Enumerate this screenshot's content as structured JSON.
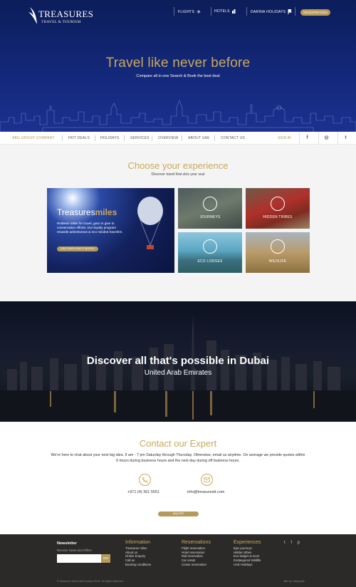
{
  "header": {
    "brand": "TREASURES",
    "brand_sub": "TRAVEL & TOURISM",
    "nav": [
      {
        "label": "FLIGHTS",
        "icon": "plane-icon"
      },
      {
        "label": "HOTELS",
        "icon": "building-icon"
      },
      {
        "label": "DARINA HOLIDAYS",
        "icon": "flag-icon"
      }
    ],
    "register_label": "REGISTRATION"
  },
  "hero": {
    "title": "Travel like never before",
    "subtitle": "Compare all in one Search & Book the best deal"
  },
  "main_nav": {
    "group": "ABG GROUP COMPANY",
    "items": [
      "HOT DEALS",
      "HOLIDAYS",
      "SERVICES",
      "OVERVIEW",
      "ABOUT UAE",
      "CONTACT US"
    ],
    "signin": "SIGN IN",
    "social": [
      "f",
      "◎",
      "t"
    ]
  },
  "experience": {
    "title": "Choose your experience",
    "subtitle": "Discover travel that stirs your soul",
    "miles": {
      "title_a": "Treasures",
      "title_b": "miles",
      "desc": "Redeem miles for travel, gear or give to conservation efforts. Our loyalty program rewards adventurous & eco minded travelers.",
      "button": "DISCOVER HOW IT WORKS"
    },
    "tiles": [
      "JOURNEYS",
      "HIDDEN TRIBES",
      "ECO LODGES",
      "WILDLIFE"
    ]
  },
  "dubai": {
    "title": "Discover all that's possible in Dubai",
    "subtitle": "United Arab Emirates"
  },
  "contact": {
    "title": "Contact our Expert",
    "desc": "We're here to chat about your next big idea. 9 am - 7 pm Saturday through Thursday. Otherwise, email us anytime. On average we provide quotes within 6 hours during business hours and the next day during off business hours.",
    "phone": "+971 (4) 361 5551",
    "email": "info@treasurestt.com",
    "button": "INQUIRE"
  },
  "footer": {
    "newsletter_title": "Newsletter",
    "newsletter_sub": "Receive News and Offers",
    "go": "GO",
    "columns": [
      {
        "heading": "Information",
        "items": [
          "Treasures miles",
          "About us",
          "Online Enquiry",
          "Call us",
          "Booking conditions"
        ]
      },
      {
        "heading": "Reservations",
        "items": [
          "Flight reservation",
          "Hotel reservation",
          "Rail reservation",
          "Car rental",
          "Cruise reservation"
        ]
      },
      {
        "heading": "Experiences",
        "items": [
          "Epic journeys",
          "Hidden tribes",
          "Eco-lodges & tours",
          "Endangered Wildlife",
          "UAE Holidays"
        ]
      }
    ],
    "social": "t f p",
    "copyright": "© treasures travel and tourism 2016. All rights reserved.",
    "credit": "Site by: Adequate"
  },
  "colors": {
    "navy": "#0c1d5a",
    "gold": "#c9a95c",
    "gold_button": "#b59a5a",
    "footer": "#2c2a28"
  }
}
